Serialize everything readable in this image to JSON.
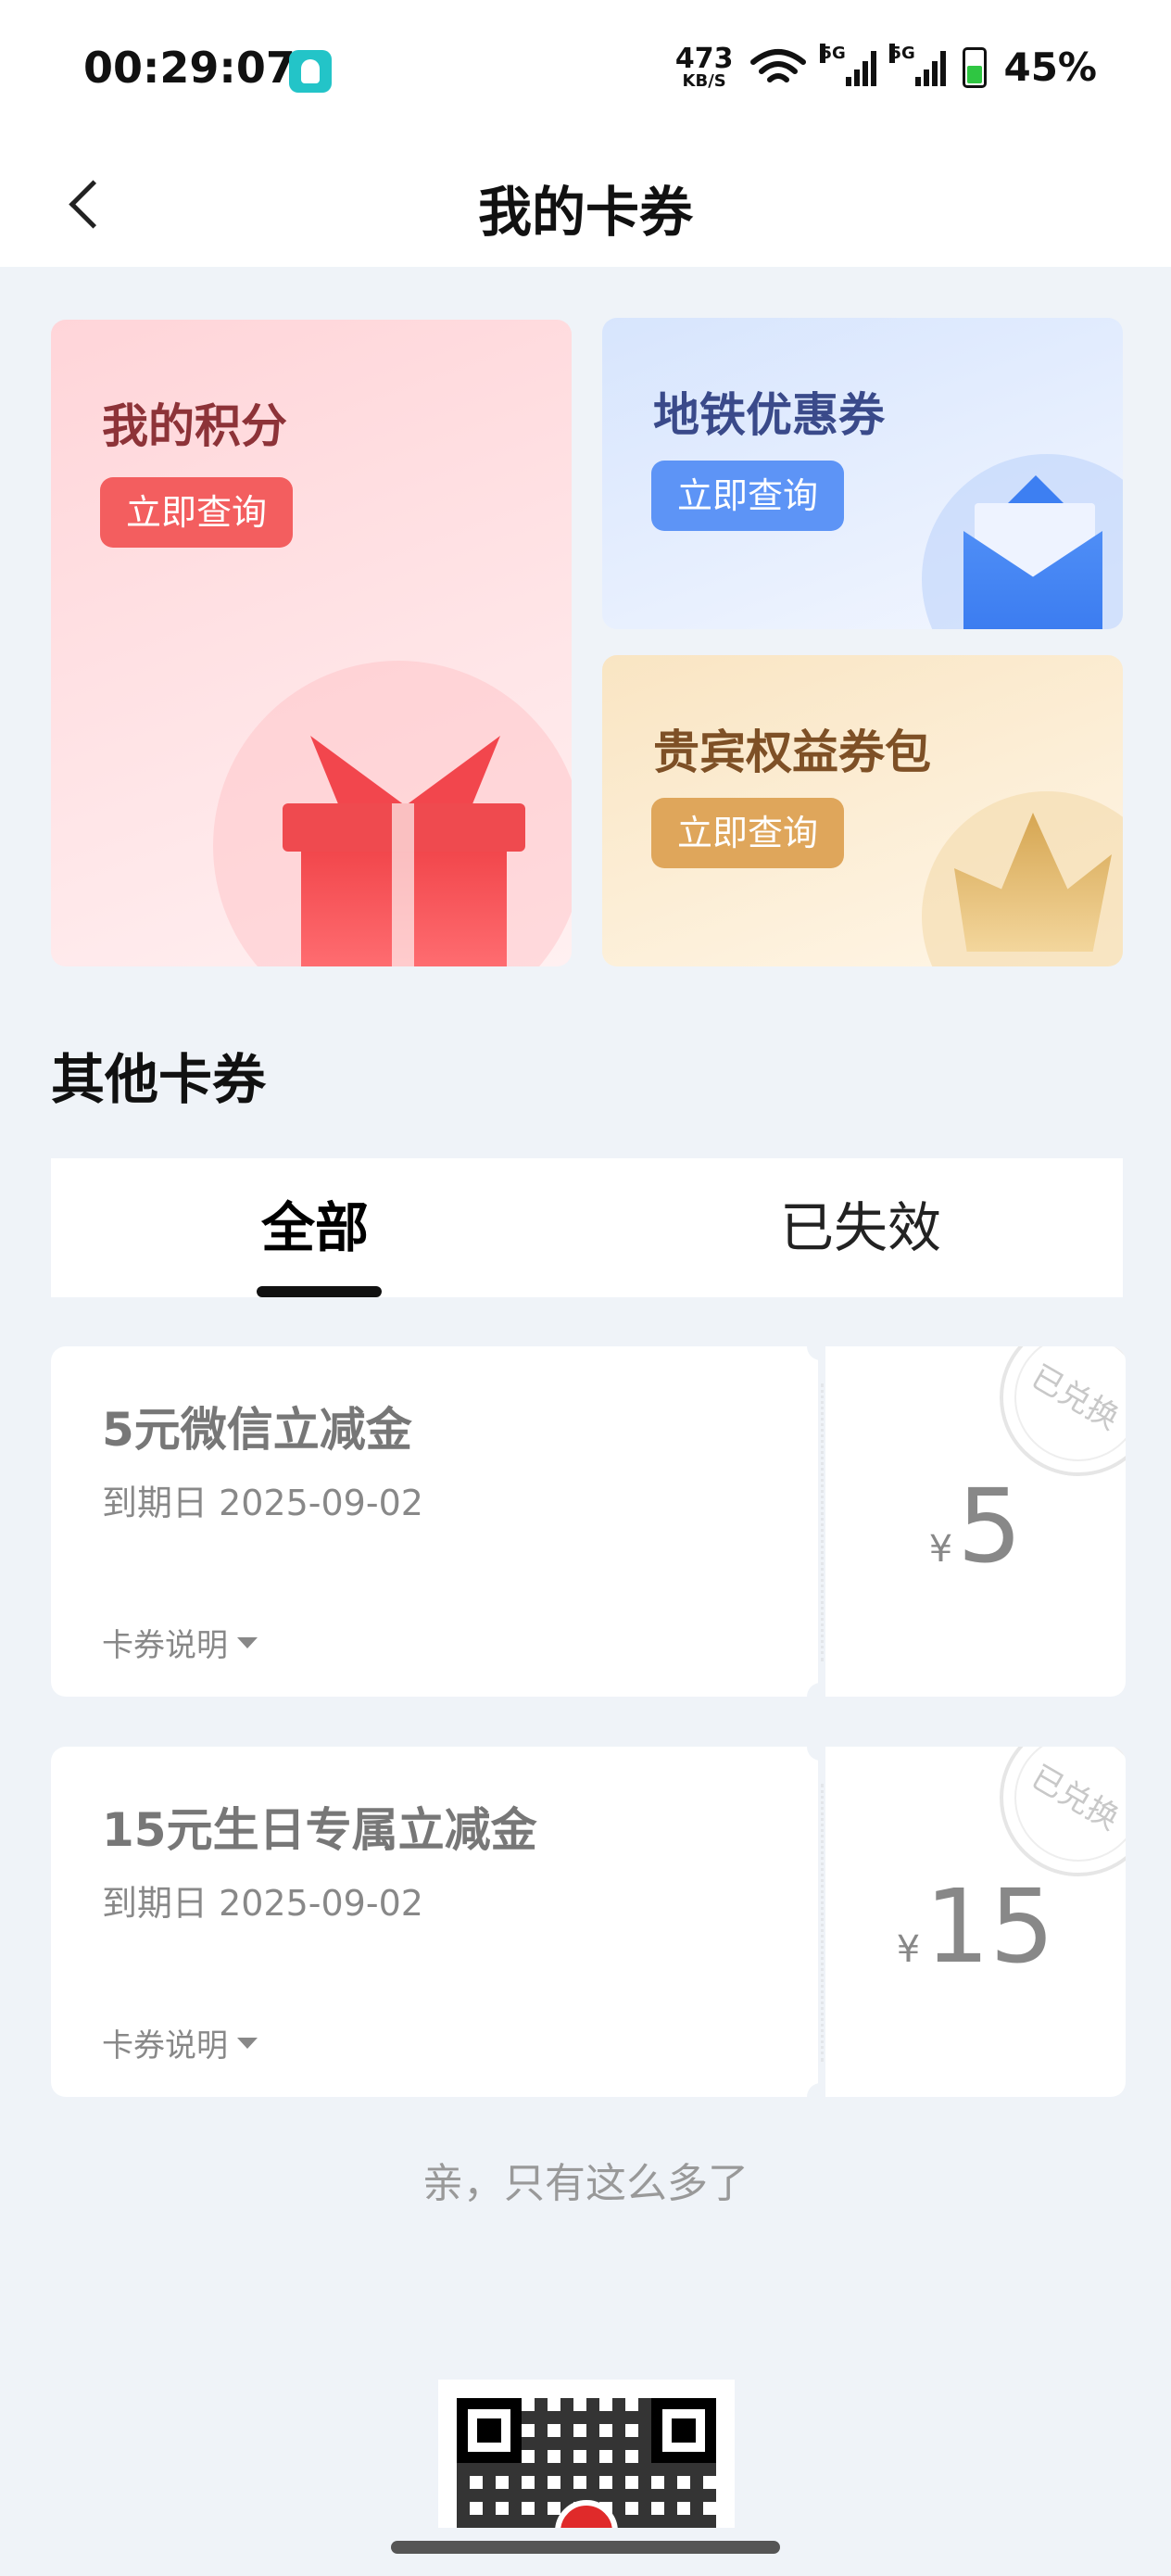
{
  "status_bar": {
    "time": "00:29:07",
    "net_speed": "473",
    "net_unit": "KB/S",
    "signal_label_1": "5G",
    "signal_label_2": "5G",
    "battery": "45%"
  },
  "nav": {
    "title": "我的卡券",
    "back_icon": "chevron-left-icon"
  },
  "cards": {
    "points": {
      "title": "我的积分",
      "button": "立即查询",
      "icon": "gift-icon"
    },
    "metro": {
      "title": "地铁优惠券",
      "button": "立即查询",
      "icon": "envelope-icon"
    },
    "vip": {
      "title": "贵宾权益券包",
      "button": "立即查询",
      "icon": "crown-icon"
    }
  },
  "section": {
    "title": "其他卡券"
  },
  "tabs": [
    {
      "label": "全部",
      "active": true
    },
    {
      "label": "已失效",
      "active": false
    }
  ],
  "coupons": [
    {
      "name": "5元微信立减金",
      "expiry": "到期日 2025-09-02",
      "desc": "卡券说明",
      "currency": "¥",
      "amount": "5",
      "stamp": "已兑换"
    },
    {
      "name": "15元生日专属立减金",
      "expiry": "到期日 2025-09-02",
      "desc": "卡券说明",
      "currency": "¥",
      "amount": "15",
      "stamp": "已兑换"
    }
  ],
  "end_note": "亲，只有这么多了",
  "colors": {
    "points_button": "#f35e5f",
    "metro_button": "#5d94f6",
    "vip_button": "#dfa65b",
    "page_bg": "#eff3f8"
  }
}
